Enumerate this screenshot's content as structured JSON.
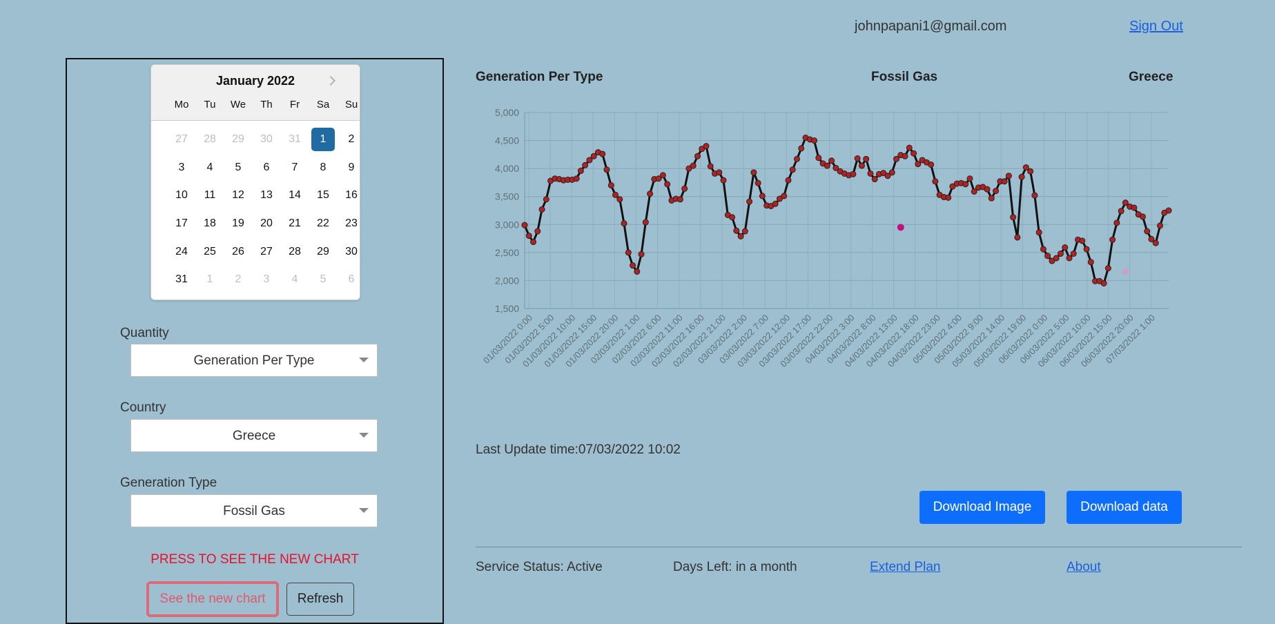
{
  "header": {
    "user_email": "johnpapani1@gmail.com",
    "sign_out": "Sign Out"
  },
  "calendar": {
    "month_label": "January 2022",
    "day_names": [
      "Mo",
      "Tu",
      "We",
      "Th",
      "Fr",
      "Sa",
      "Su"
    ],
    "weeks": [
      [
        "27",
        "28",
        "29",
        "30",
        "31",
        "1",
        "2"
      ],
      [
        "3",
        "4",
        "5",
        "6",
        "7",
        "8",
        "9"
      ],
      [
        "10",
        "11",
        "12",
        "13",
        "14",
        "15",
        "16"
      ],
      [
        "17",
        "18",
        "19",
        "20",
        "21",
        "22",
        "23"
      ],
      [
        "24",
        "25",
        "26",
        "27",
        "28",
        "29",
        "30"
      ],
      [
        "31",
        "1",
        "2",
        "3",
        "4",
        "5",
        "6"
      ]
    ],
    "selected": "1"
  },
  "filters": {
    "quantity_label": "Quantity",
    "quantity_value": "Generation Per Type",
    "country_label": "Country",
    "country_value": "Greece",
    "gentype_label": "Generation Type",
    "gentype_value": "Fossil Gas"
  },
  "actions": {
    "press_text": "PRESS TO SEE THE NEW CHART",
    "new_chart": "See the new chart",
    "refresh": "Refresh",
    "download_image": "Download Image",
    "download_data": "Download data"
  },
  "chart_header": {
    "quantity": "Generation Per Type",
    "type": "Fossil Gas",
    "country": "Greece"
  },
  "last_update": "Last Update time:07/03/2022 10:02",
  "footer": {
    "service_status": "Service Status: Active",
    "days_left": "Days Left: in a month",
    "extend_plan": "Extend Plan",
    "about": "About"
  },
  "colors": {
    "background": "#9dbfcf",
    "line": "#111111",
    "point": "#b22222",
    "accent": "#0d6efd",
    "selected_day": "#216ba5"
  },
  "chart_data": {
    "type": "line",
    "title": "",
    "xlabel": "",
    "ylabel": "",
    "ylim": [
      1500,
      5000
    ],
    "yticks": [
      "1,500",
      "2,000",
      "2,500",
      "3,000",
      "3,500",
      "4,000",
      "4,500",
      "5,000"
    ],
    "x_tick_labels": [
      "01/03/2022 0:00",
      "01/03/2022 5:00",
      "01/03/2022 10:00",
      "01/03/2022 15:00",
      "01/03/2022 20:00",
      "02/03/2022 1:00",
      "02/03/2022 6:00",
      "02/03/2022 11:00",
      "02/03/2022 16:00",
      "02/03/2022 21:00",
      "03/03/2022 2:00",
      "03/03/2022 7:00",
      "03/03/2022 12:00",
      "03/03/2022 17:00",
      "03/03/2022 22:00",
      "04/03/2022 3:00",
      "04/03/2022 8:00",
      "04/03/2022 13:00",
      "04/03/2022 18:00",
      "04/03/2022 23:00",
      "05/03/2022 4:00",
      "05/03/2022 9:00",
      "05/03/2022 14:00",
      "05/03/2022 19:00",
      "06/03/2022 0:00",
      "06/03/2022 5:00",
      "06/03/2022 10:00",
      "06/03/2022 15:00",
      "06/03/2022 20:00",
      "07/03/2022 1:00"
    ],
    "x_start": "01/03/2022 0:00",
    "x_step": "1 hour",
    "values": [
      2990,
      2800,
      2690,
      2880,
      3270,
      3450,
      3780,
      3820,
      3810,
      3790,
      3800,
      3800,
      3820,
      3960,
      4060,
      4150,
      4220,
      4290,
      4260,
      3980,
      3700,
      3530,
      3450,
      3020,
      2500,
      2270,
      2160,
      2470,
      3040,
      3550,
      3810,
      3820,
      3880,
      3720,
      3430,
      3460,
      3450,
      3640,
      4000,
      4050,
      4220,
      4350,
      4400,
      4040,
      3910,
      3930,
      3790,
      3170,
      3130,
      2890,
      2790,
      2880,
      3410,
      3930,
      3740,
      3510,
      3340,
      3330,
      3370,
      3460,
      3510,
      3790,
      3980,
      4170,
      4360,
      4550,
      4520,
      4500,
      4190,
      4090,
      4050,
      4140,
      4010,
      3950,
      3910,
      3880,
      3900,
      4180,
      4050,
      4170,
      3910,
      3810,
      3900,
      3920,
      3870,
      3930,
      4170,
      4240,
      4220,
      4370,
      4270,
      4080,
      4150,
      4110,
      4070,
      3770,
      3530,
      3490,
      3480,
      3680,
      3730,
      3740,
      3720,
      3820,
      3590,
      3660,
      3670,
      3630,
      3470,
      3600,
      3770,
      3770,
      3870,
      3130,
      2770,
      3850,
      4020,
      3950,
      3520,
      2860,
      2560,
      2440,
      2350,
      2400,
      2480,
      2590,
      2400,
      2480,
      2730,
      2710,
      2560,
      2330,
      1990,
      1990,
      1950,
      2220,
      2730,
      3030,
      3240,
      3390,
      3320,
      3300,
      3180,
      3140,
      2880,
      2740,
      2670,
      2980,
      3210,
      3250
    ],
    "extra_points": [
      {
        "x_index": 87,
        "y": 2950,
        "color": "#c0127a"
      },
      {
        "x_index": 139,
        "y": 2160,
        "color": "#c9a3c1"
      }
    ]
  }
}
